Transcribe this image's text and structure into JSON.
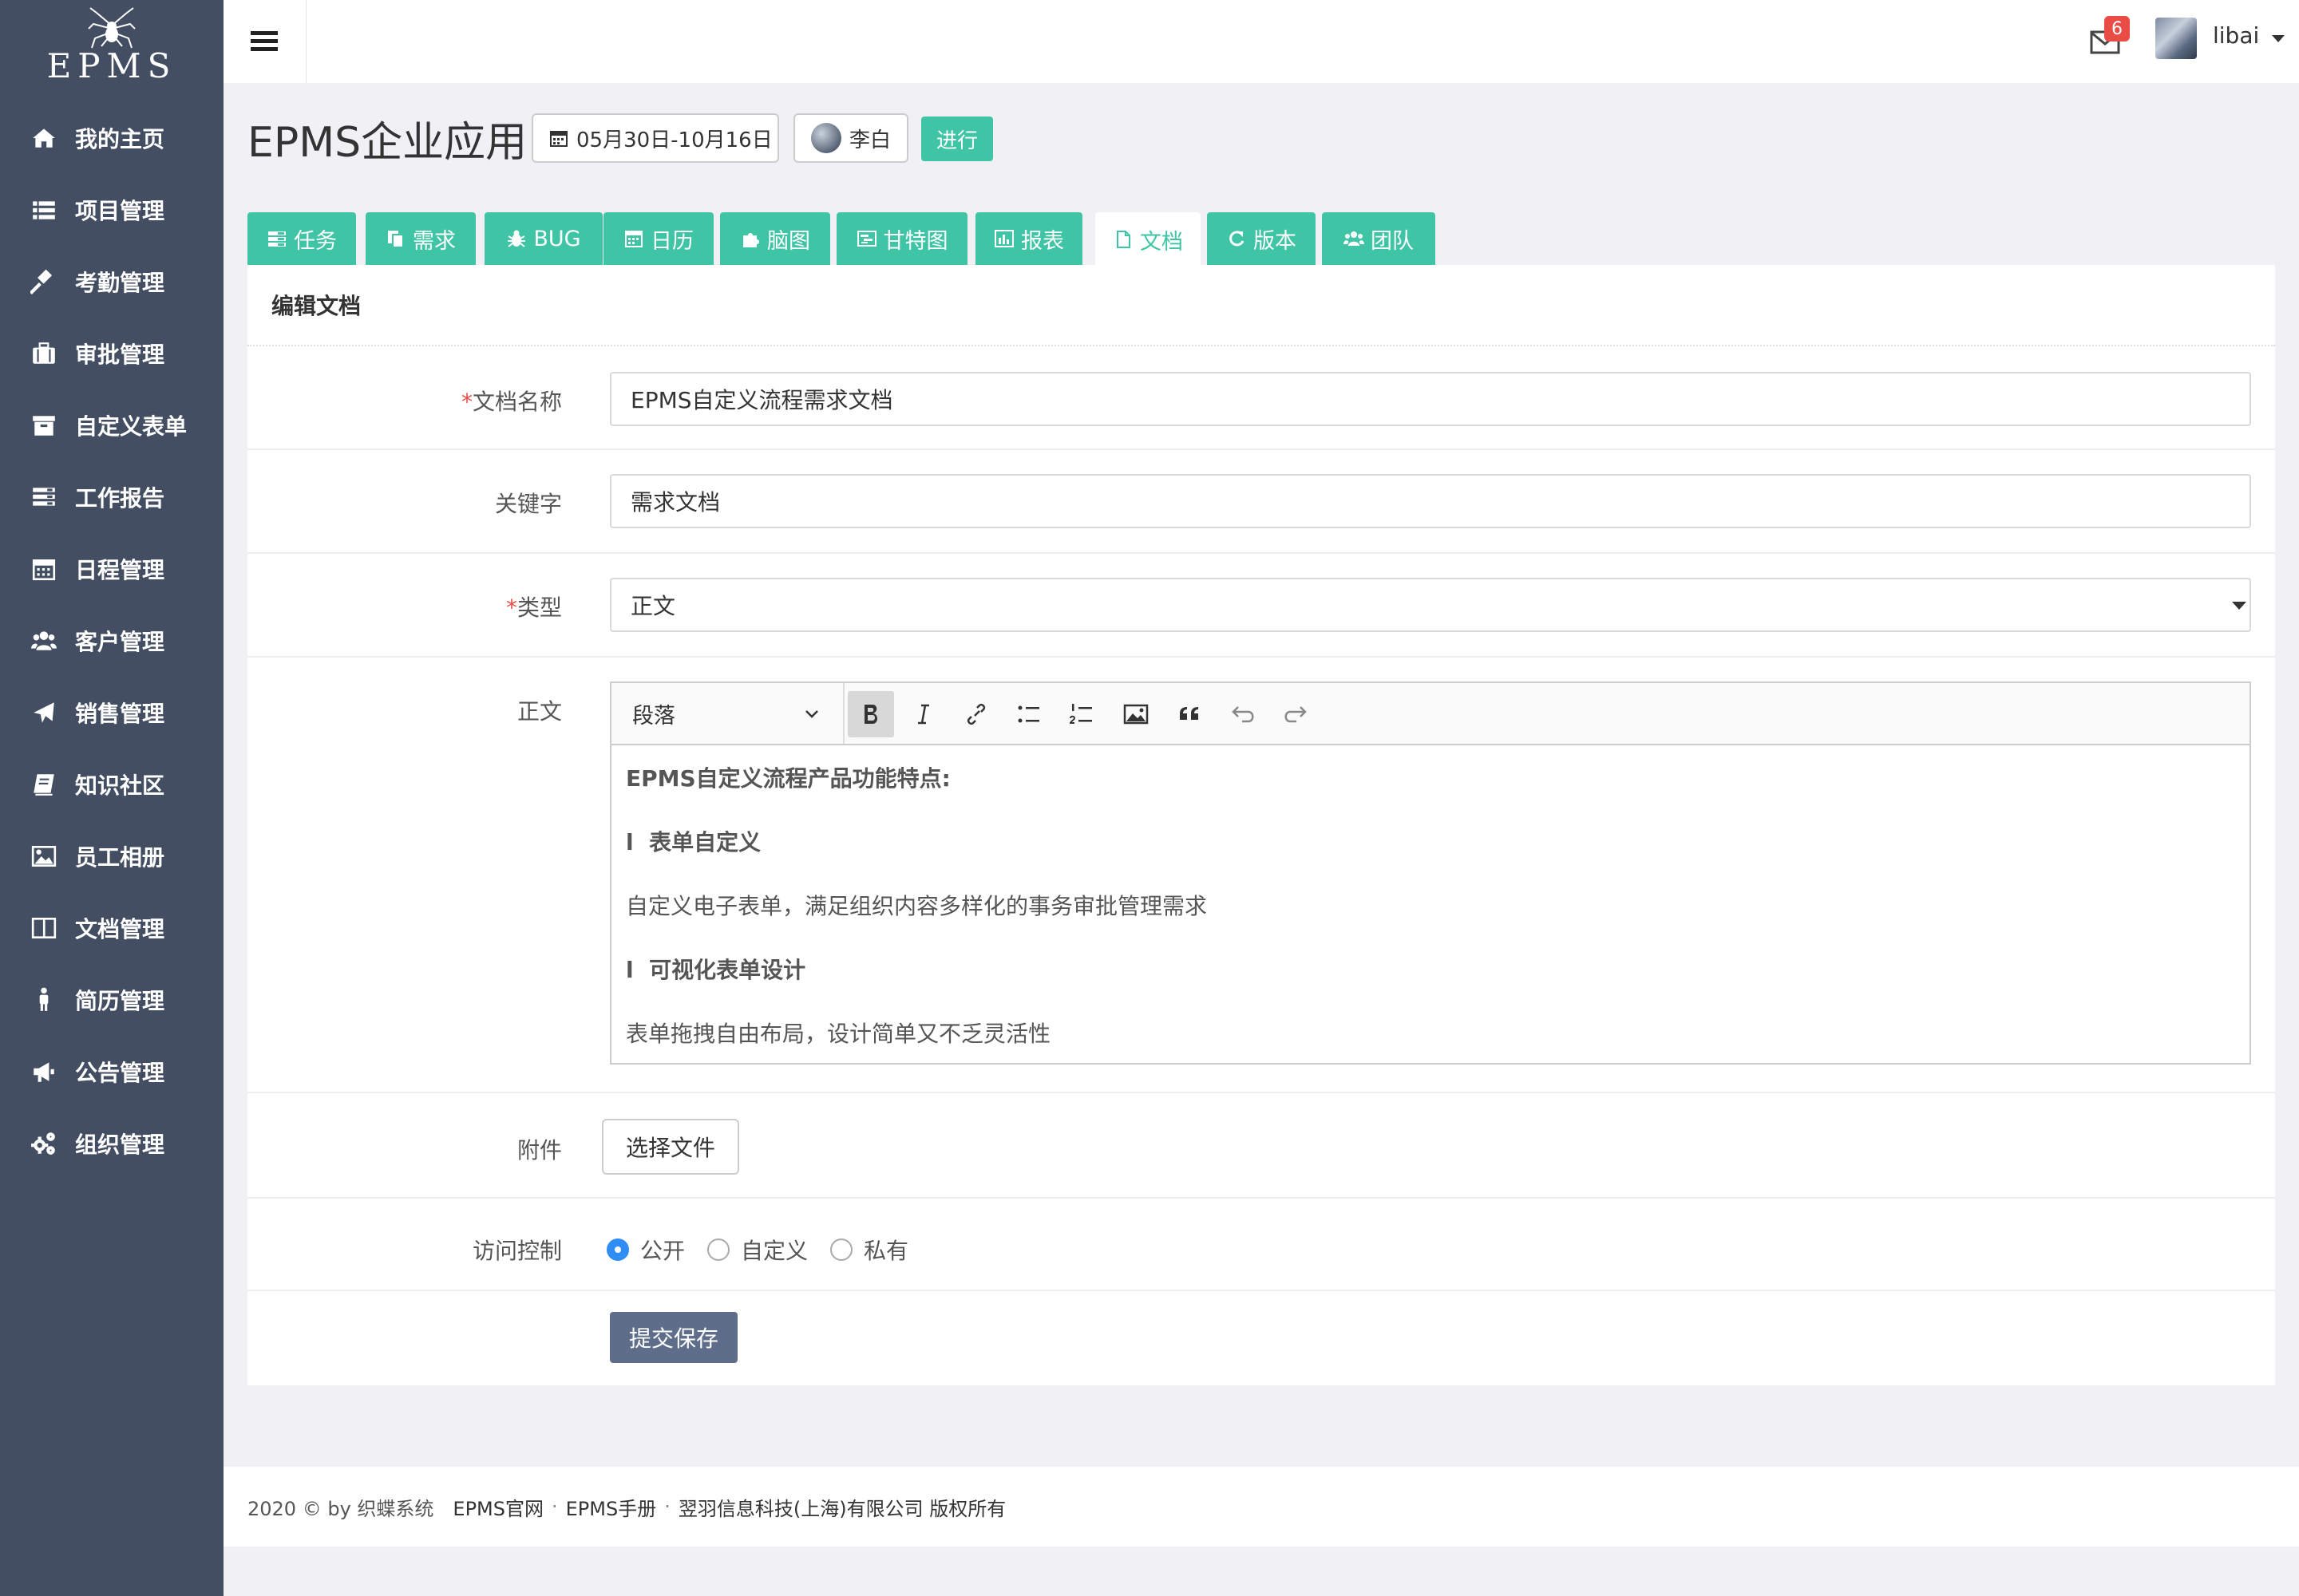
{
  "brand": {
    "logo_text": "EPMS"
  },
  "sidebar": {
    "items": [
      {
        "label": "我的主页",
        "icon": "home-icon"
      },
      {
        "label": "项目管理",
        "icon": "list-icon"
      },
      {
        "label": "考勤管理",
        "icon": "gavel-icon"
      },
      {
        "label": "审批管理",
        "icon": "briefcase-icon"
      },
      {
        "label": "自定义表单",
        "icon": "archive-icon"
      },
      {
        "label": "工作报告",
        "icon": "report-icon"
      },
      {
        "label": "日程管理",
        "icon": "calendar-icon"
      },
      {
        "label": "客户管理",
        "icon": "users-icon"
      },
      {
        "label": "销售管理",
        "icon": "plane-icon"
      },
      {
        "label": "知识社区",
        "icon": "book-icon"
      },
      {
        "label": "员工相册",
        "icon": "image-icon"
      },
      {
        "label": "文档管理",
        "icon": "columns-icon"
      },
      {
        "label": "简历管理",
        "icon": "person-icon"
      },
      {
        "label": "公告管理",
        "icon": "bullhorn-icon"
      },
      {
        "label": "组织管理",
        "icon": "cogs-icon"
      }
    ]
  },
  "topbar": {
    "mail_count": "6",
    "username": "libai"
  },
  "project": {
    "title": "EPMS企业应用",
    "date_range": "05月30日-10月16日",
    "owner": "李白",
    "status": "进行"
  },
  "tabs": [
    {
      "label": "任务",
      "icon": "tasks-icon"
    },
    {
      "label": "需求",
      "icon": "copy-icon"
    },
    {
      "label": "BUG",
      "icon": "bug-icon"
    },
    {
      "label": "日历",
      "icon": "calendar-icon"
    },
    {
      "label": "脑图",
      "icon": "puzzle-icon"
    },
    {
      "label": "甘特图",
      "icon": "gantt-icon"
    },
    {
      "label": "报表",
      "icon": "bar-chart-icon"
    },
    {
      "label": "文档",
      "icon": "file-icon",
      "active": true
    },
    {
      "label": "版本",
      "icon": "refresh-icon"
    },
    {
      "label": "团队",
      "icon": "group-icon"
    }
  ],
  "form": {
    "heading": "编辑文档",
    "name_label": "文档名称",
    "name_value": "EPMS自定义流程需求文档",
    "keyword_label": "关键字",
    "keyword_value": "需求文档",
    "type_label": "类型",
    "type_value": "正文",
    "body_label": "正文",
    "required_mark": "*",
    "editor": {
      "paragraph_select": "段落",
      "content": {
        "line1": "EPMS自定义流程产品功能特点:",
        "line2_bullet": "l",
        "line2": "表单自定义",
        "line3": "自定义电子表单，满足组织内容多样化的事务审批管理需求",
        "line4_bullet": "l",
        "line4": "可视化表单设计",
        "line5": "表单拖拽自由布局，设计简单又不乏灵活性"
      }
    },
    "attachment_label": "附件",
    "file_button": "选择文件",
    "access_label": "访问控制",
    "access_options": [
      "公开",
      "自定义",
      "私有"
    ],
    "access_selected": "公开",
    "submit_label": "提交保存"
  },
  "footer": {
    "copyright": "2020 © by 织蝶系统",
    "link1": "EPMS官网",
    "link2": "EPMS手册",
    "link3": "翌羽信息科技(上海)有限公司 版权所有",
    "separator": "·"
  },
  "colors": {
    "sidebar_bg": "#434e62",
    "accent": "#3fc5a6",
    "badge": "#e94b45",
    "primary_button": "#5e6e8a",
    "radio_checked": "#2f8df4"
  }
}
